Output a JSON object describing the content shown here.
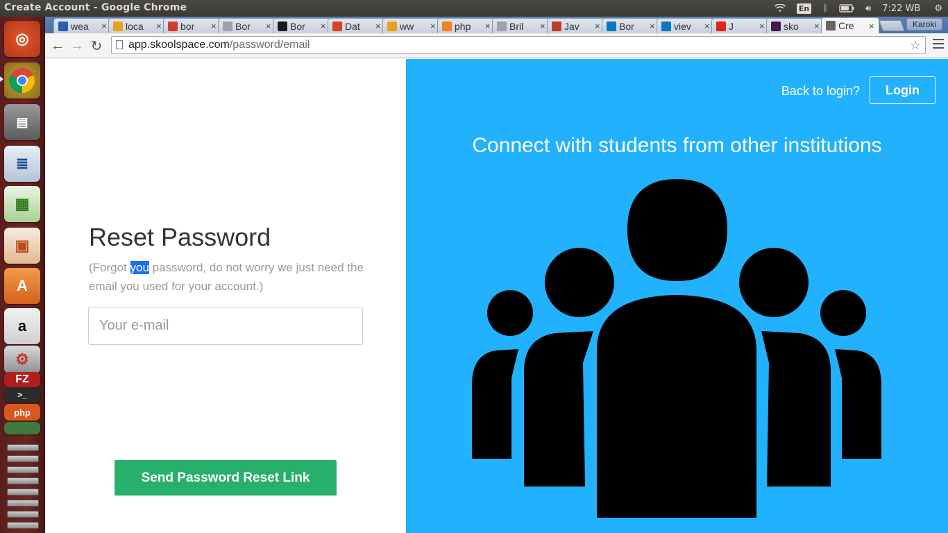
{
  "top_panel": {
    "window_title": "Create Account - Google Chrome",
    "language": "En",
    "clock": "7:22 WB"
  },
  "browser": {
    "tabs": [
      {
        "title": "wea",
        "icon": "shield-icon",
        "color": "#2a5db0"
      },
      {
        "title": "loca",
        "icon": "phpmyadmin-icon",
        "color": "#e8a21b"
      },
      {
        "title": "bor",
        "icon": "gmail-icon",
        "color": "#d23b2e"
      },
      {
        "title": "Bor",
        "icon": "document-icon",
        "color": "#9aa3ad"
      },
      {
        "title": "Bor",
        "icon": "star-icon",
        "color": "#1a1a1a"
      },
      {
        "title": "Dat",
        "icon": "grid-icon",
        "color": "#d9412b"
      },
      {
        "title": "ww",
        "icon": "phpmyadmin-icon",
        "color": "#e8a21b"
      },
      {
        "title": "php",
        "icon": "stackoverflow-icon",
        "color": "#f48024"
      },
      {
        "title": "Bril",
        "icon": "document-icon",
        "color": "#9aa3ad"
      },
      {
        "title": "Jav",
        "icon": "basket-icon",
        "color": "#c0392b"
      },
      {
        "title": "Bor",
        "icon": "drupal-icon",
        "color": "#0a76c4"
      },
      {
        "title": "viev",
        "icon": "drupal-icon",
        "color": "#0a76c4"
      },
      {
        "title": "J",
        "icon": "youtube-icon",
        "color": "#e62117"
      },
      {
        "title": "sko",
        "icon": "slack-icon",
        "color": "#4a154b"
      },
      {
        "title": "Cre",
        "icon": "skoolspace-icon",
        "color": "#666666"
      }
    ],
    "profile_name": "Karoki",
    "url_host": "app.skoolspace.com",
    "url_path": "/password/email"
  },
  "form": {
    "title": "Reset Password",
    "help_before": "(Forgot ",
    "help_highlight": "you",
    "help_after": " password, do not worry we just need the email you used for your account.)",
    "email_placeholder": "Your e-mail",
    "email_value": "",
    "submit_label": "Send Password Reset Link"
  },
  "aside": {
    "back_to_login": "Back to login?",
    "login_label": "Login",
    "tagline": "Connect with students from other institutions",
    "illustration": "group-of-people-icon"
  },
  "colors": {
    "accent_blue": "#21b1fd",
    "button_green": "#27b06b",
    "launcher": "#6e2522"
  }
}
